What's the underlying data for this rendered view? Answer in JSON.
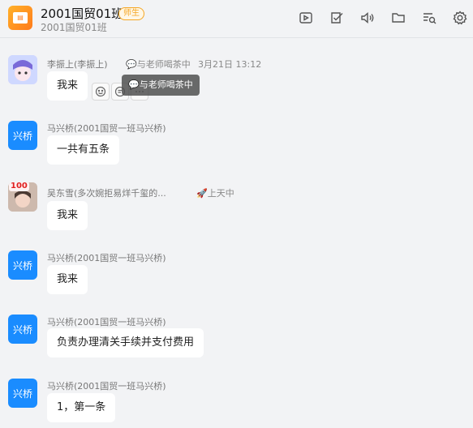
{
  "header": {
    "title": "2001国贸01班",
    "badge": "师生",
    "subtitle": "2001国贸01班",
    "tools": [
      "video-icon",
      "check-icon",
      "volume-icon",
      "folder-icon",
      "search-list-icon",
      "settings-icon"
    ]
  },
  "messages": [
    {
      "sender": "李振上(李振上)",
      "status": "与老师喝茶中",
      "time": "3月21日 13:12",
      "text": "我来",
      "avatar_label": ""
    },
    {
      "sender": "马兴桥(2001国贸一班马兴桥)",
      "text": "一共有五条",
      "avatar_label": "兴桥"
    },
    {
      "sender": "吴东雪(多次婉拒易烊千玺的...",
      "status": "上天中",
      "text": "我来",
      "avatar_label": "100"
    },
    {
      "sender": "马兴桥(2001国贸一班马兴桥)",
      "text": "我来",
      "avatar_label": "兴桥"
    },
    {
      "sender": "马兴桥(2001国贸一班马兴桥)",
      "text": "负责办理清关手续并支付费用",
      "avatar_label": "兴桥"
    },
    {
      "sender": "马兴桥(2001国贸一班马兴桥)",
      "text": "1，第一条",
      "avatar_label": "兴桥"
    }
  ],
  "tooltip": "与老师喝茶中",
  "colors": {
    "accent_blue": "#1a8cff",
    "badge_orange": "#f5a623",
    "background": "#f2f3f5"
  }
}
